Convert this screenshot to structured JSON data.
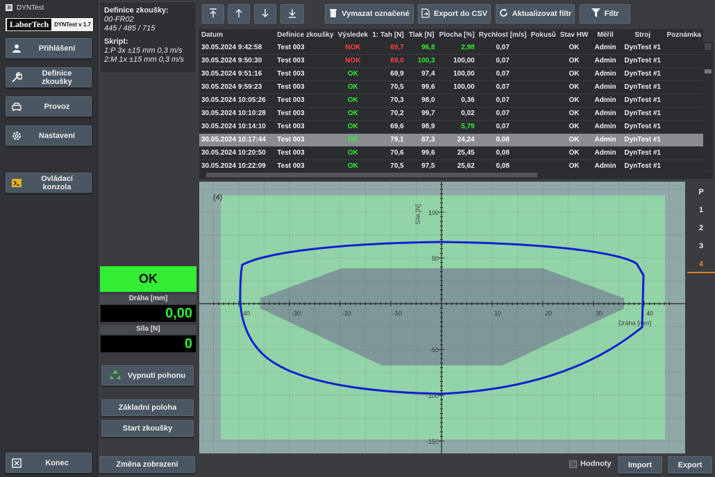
{
  "app": {
    "title": "DYNTest",
    "icon_text": "3I",
    "brand": "LaborTech",
    "version": "DYNTest v 1.7"
  },
  "nav": {
    "items": [
      {
        "label": "Přihlášení",
        "icon": "user-icon"
      },
      {
        "label": "Definice zkoušky",
        "icon": "wrench-icon"
      },
      {
        "label": "Provoz",
        "icon": "car-icon"
      },
      {
        "label": "Nastavení",
        "icon": "gear-icon"
      }
    ],
    "console": "Ovládací konzola",
    "exit": "Konec"
  },
  "definition": {
    "heading": "Definice zkoušky:",
    "code": "00-FR02",
    "dims": "445 / 485 / 715",
    "script_heading": "Skript:",
    "line1": "1:P  3x  ±15 mm  0,3 m/s",
    "line2": "2:M  1x  ±15 mm  0,3 m/s"
  },
  "status": {
    "result": "OK",
    "color": "#33ee33"
  },
  "readouts": {
    "path_label": "Dráha [mm]",
    "path_value": "0,00",
    "force_label": "Síla [N]",
    "force_value": "0"
  },
  "actions": {
    "drive_off": "Vypnutí pohonu",
    "home": "Základní poloha",
    "start": "Start zkoušky",
    "change_view": "Změna zobrazení"
  },
  "toolbar": {
    "delete_selected": "Vymazat označené",
    "export_csv": "Export do CSV",
    "refresh_filter": "Aktualizovat filtr",
    "filter": "Filtr"
  },
  "table": {
    "columns": [
      "Datum",
      "Definice zkoušky",
      "Výsledek",
      "1: Tah [N]",
      "Tlak [N]",
      "Plocha [%]",
      "Rychlost [m/s]",
      "Pokusů",
      "Stav HW",
      "Měřil",
      "Stroj",
      "Poznámka"
    ],
    "rows": [
      [
        "30.05.2024 9:42:58",
        "Test 003",
        "NOK",
        "69,7",
        "96,8",
        "2,98",
        "0,07",
        "",
        "OK",
        "Admin",
        "DynTest #1",
        ""
      ],
      [
        "30.05.2024 9:50:30",
        "Test 003",
        "NOK",
        "69,0",
        "100,3",
        "100,00",
        "0,07",
        "",
        "OK",
        "Admin",
        "DynTest #1",
        ""
      ],
      [
        "30.05.2024 9:51:16",
        "Test 003",
        "OK",
        "69,9",
        "97,4",
        "100,00",
        "0,07",
        "",
        "OK",
        "Admin",
        "DynTest #1",
        ""
      ],
      [
        "30.05.2024 9:59:23",
        "Test 003",
        "OK",
        "70,5",
        "99,6",
        "100,00",
        "0,07",
        "",
        "OK",
        "Admin",
        "DynTest #1",
        ""
      ],
      [
        "30.05.2024 10:05:26",
        "Test 003",
        "OK",
        "70,3",
        "98,0",
        "0,36",
        "0,07",
        "",
        "OK",
        "Admin",
        "DynTest #1",
        ""
      ],
      [
        "30.05.2024 10:10:28",
        "Test 003",
        "OK",
        "70,2",
        "99,7",
        "0,02",
        "0,07",
        "",
        "OK",
        "Admin",
        "DynTest #1",
        ""
      ],
      [
        "30.05.2024 10:14:10",
        "Test 003",
        "OK",
        "69,6",
        "98,9",
        "5,79",
        "0,07",
        "",
        "OK",
        "Admin",
        "DynTest #1",
        ""
      ],
      [
        "30.05.2024 10:17:44",
        "Test 003",
        "OK",
        "79,1",
        "87,3",
        "24,24",
        "0,08",
        "",
        "OK",
        "Admin",
        "DynTest #1",
        ""
      ],
      [
        "30.05.2024 10:20:50",
        "Test 003",
        "OK",
        "70,6",
        "99,6",
        "25,45",
        "0,08",
        "",
        "OK",
        "Admin",
        "DynTest #1",
        ""
      ],
      [
        "30.05.2024 10:22:09",
        "Test 003",
        "OK",
        "70,5",
        "97,5",
        "25,62",
        "0,08",
        "",
        "OK",
        "Admin",
        "DynTest #1",
        ""
      ]
    ],
    "selected_row": 7,
    "cell_colors": {
      "0": {
        "2": "#ff4040",
        "3": "#ff4040",
        "4": "#33ee33",
        "5": "#33ee33"
      },
      "1": {
        "2": "#ff4040",
        "3": "#ff4040",
        "4": "#33ee33"
      },
      "2": {
        "2": "#33ee33"
      },
      "3": {
        "2": "#33ee33"
      },
      "4": {
        "2": "#33ee33"
      },
      "5": {
        "2": "#33ee33"
      },
      "6": {
        "2": "#33ee33",
        "5": "#33ee33"
      },
      "7": {
        "2": "#33ee33"
      },
      "8": {
        "2": "#33ee33"
      },
      "9": {
        "2": "#33ee33"
      }
    }
  },
  "plot": {
    "cycle_label": "(4)",
    "x_axis_label": "Dráha [mm]",
    "y_axis_label": "Síla [N]",
    "x_ticks": [
      -40,
      -30,
      -20,
      -10,
      10,
      20,
      30,
      40
    ],
    "y_ticks": [
      100,
      50,
      -50,
      -100,
      -150
    ],
    "outer_band_color": "#93d3a8",
    "inner_band_color": "#8fa9a8",
    "curve_color": "#1020d0"
  },
  "plot_tabs": [
    "P",
    "1",
    "2",
    "3",
    "4"
  ],
  "active_tab": 4,
  "bottom": {
    "values_label": "Hodnoty",
    "import": "Import",
    "export": "Export"
  }
}
